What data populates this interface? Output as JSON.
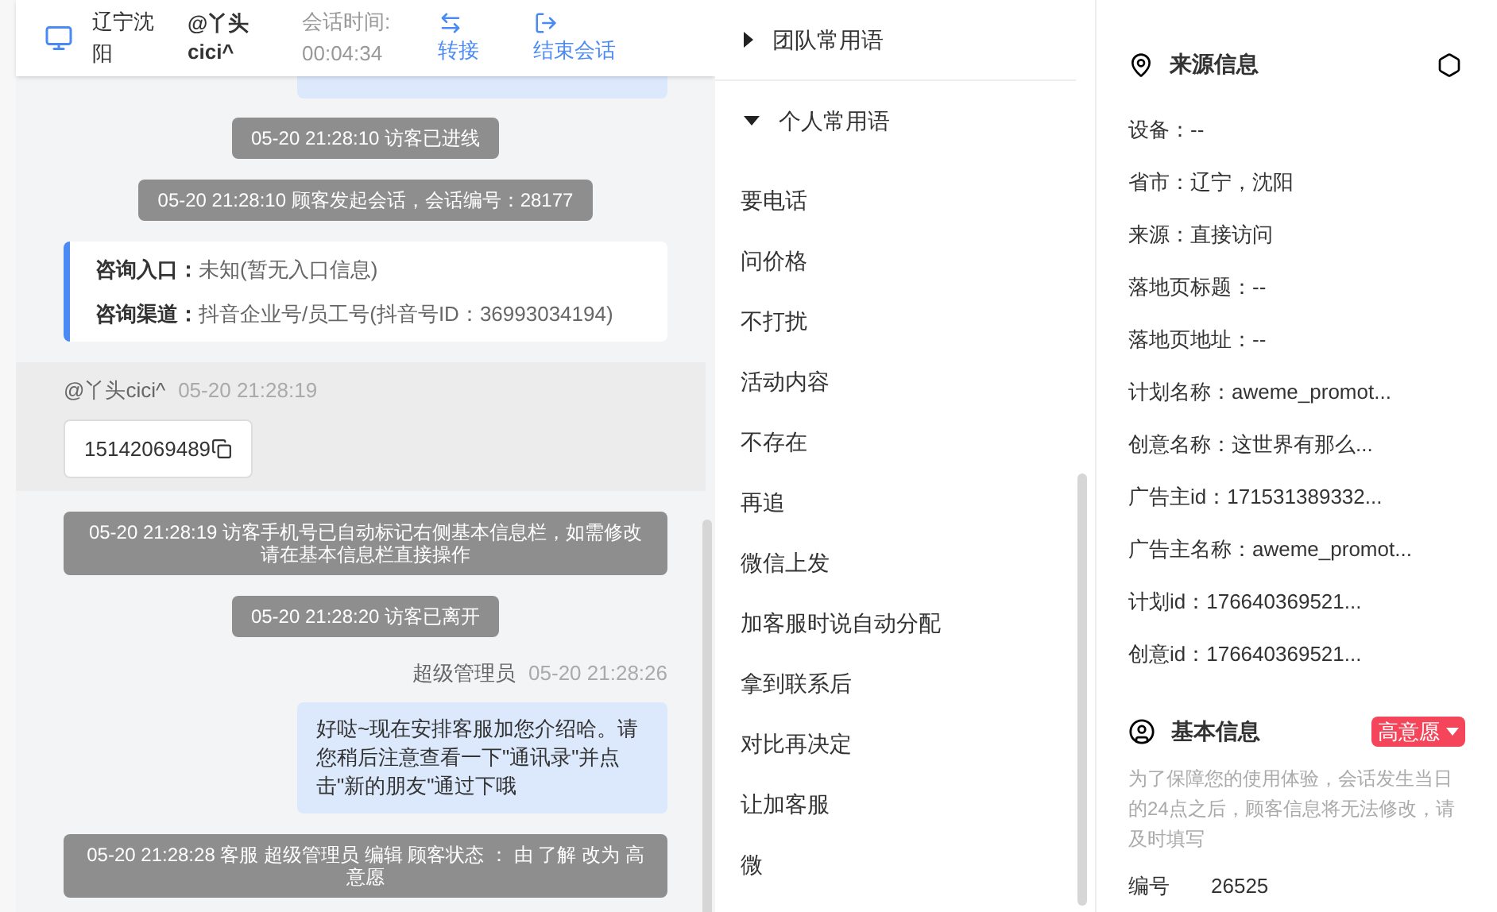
{
  "header": {
    "location": "辽宁沈阳",
    "visitor": "@丫头cici^",
    "session_label": "会话时间:",
    "session_time": "00:04:34",
    "actions": [
      {
        "kind": "transfer",
        "label": "转接"
      },
      {
        "kind": "end",
        "label": "结束会话"
      }
    ]
  },
  "messages": [
    {
      "kind": "system",
      "text": "05-20 21:28:10 访客已进线"
    },
    {
      "kind": "system",
      "text": "05-20 21:28:10 顾客发起会话，会话编号：28177"
    },
    {
      "kind": "info",
      "lines": [
        {
          "label": "咨询入口：",
          "value": "未知(暂无入口信息)"
        },
        {
          "label": "咨询渠道：",
          "value": "抖音企业号/员工号(抖音号ID：36993034194)"
        }
      ]
    },
    {
      "kind": "visitor",
      "sender": "@丫头cici^",
      "time": "05-20 21:28:19",
      "text": "15142069489"
    },
    {
      "kind": "system",
      "text": "05-20 21:28:19 访客手机号已自动标记右侧基本信息栏，如需修改请在基本信息栏直接操作"
    },
    {
      "kind": "system",
      "text": "05-20 21:28:20 访客已离开"
    },
    {
      "kind": "agent",
      "sender": "超级管理员",
      "time": "05-20 21:28:26",
      "text": "好哒~现在安排客服加您介绍哈。请您稍后注意查看一下\"通讯录\"并点击\"新的朋友\"通过下哦"
    },
    {
      "kind": "system",
      "text": "05-20 21:28:28 客服 超级管理员 编辑 顾客状态 ： 由 了解 改为 高意愿"
    }
  ],
  "phrase_groups": [
    {
      "title": "团队常用语",
      "expanded": false
    },
    {
      "title": "个人常用语",
      "expanded": true,
      "items": [
        "要电话",
        "问价格",
        "不打扰",
        "活动内容",
        "不存在",
        "再追",
        "微信上发",
        "加客服时说自动分配",
        "拿到联系后",
        "对比再决定",
        "让加客服",
        "微"
      ]
    }
  ],
  "source_info": {
    "title": "来源信息",
    "fields": [
      "设备：--",
      "省市：辽宁，沈阳",
      "来源：直接访问",
      "落地页标题：--",
      "落地页地址：--",
      "计划名称：aweme_promot...",
      "创意名称：这世界有那么...",
      "广告主id：171531389332...",
      "广告主名称：aweme_promot...",
      "计划id：176640369521...",
      "创意id：176640369521..."
    ]
  },
  "basic_info": {
    "title": "基本信息",
    "intent": "高意愿",
    "note": "为了保障您的使用体验，会话发生当日的24点之后，顾客信息将无法修改，请及时填写",
    "fields": [
      {
        "label": "编号",
        "value": "26525"
      }
    ]
  }
}
